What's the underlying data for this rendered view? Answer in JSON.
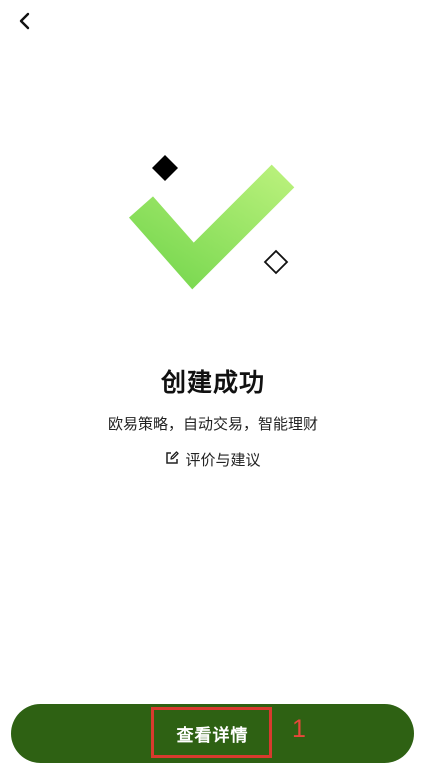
{
  "nav": {
    "back_icon": "chevron-left-icon"
  },
  "hero": {
    "check_icon": "checkmark-icon",
    "decor_icons": [
      "filled-diamond-icon",
      "outline-diamond-icon"
    ],
    "check_color_start": "#79d850",
    "check_color_end": "#b7f07a"
  },
  "result": {
    "title": "创建成功",
    "subtitle": "欧易策略，自动交易，智能理财",
    "feedback_icon": "edit-icon",
    "feedback_label": "评价与建议"
  },
  "footer": {
    "primary_label": "查看详情",
    "primary_color": "#2e6113"
  },
  "annotation": {
    "number": "1",
    "color": "#d83a2e"
  }
}
